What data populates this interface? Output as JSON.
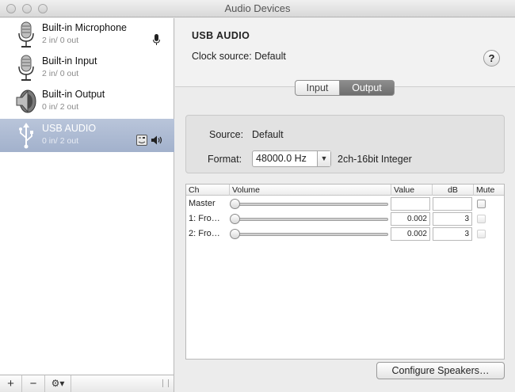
{
  "window": {
    "title": "Audio Devices"
  },
  "sidebar": {
    "devices": [
      {
        "name": "Built-in Microphone",
        "io": "2 in/ 0 out",
        "icon": "microphone-icon",
        "selected": false,
        "badge": "microphone-icon"
      },
      {
        "name": "Built-in Input",
        "io": "2 in/ 0 out",
        "icon": "microphone-icon",
        "selected": false
      },
      {
        "name": "Built-in Output",
        "io": "0 in/ 2 out",
        "icon": "speaker-icon",
        "selected": false
      },
      {
        "name": "USB  AUDIO",
        "io": "0 in/ 2 out",
        "icon": "usb-icon",
        "selected": true,
        "badge": "finder-speaker-icon"
      }
    ],
    "bottom": {
      "add": "+",
      "remove": "−",
      "action": "⚙▾"
    }
  },
  "device": {
    "title": "USB  AUDIO",
    "clock_label": "Clock source:",
    "clock_value": "Default",
    "help": "?"
  },
  "tabs": {
    "input": "Input",
    "output": "Output",
    "active": "output"
  },
  "format": {
    "source_label": "Source:",
    "source_value": "Default",
    "format_label": "Format:",
    "rate": "48000.0 Hz",
    "bits": "2ch-16bit Integer"
  },
  "channels": {
    "headers": {
      "ch": "Ch",
      "volume": "Volume",
      "value": "Value",
      "db": "dB",
      "mute": "Mute"
    },
    "rows": [
      {
        "label": "Master",
        "value": "",
        "db": "",
        "level": 0.0,
        "mute_enabled": true
      },
      {
        "label": "1: Fro…",
        "value": "0.002",
        "db": "3",
        "level": 0.0,
        "mute_enabled": false
      },
      {
        "label": "2: Fro…",
        "value": "0.002",
        "db": "3",
        "level": 0.0,
        "mute_enabled": false
      }
    ]
  },
  "buttons": {
    "configure": "Configure Speakers…"
  }
}
